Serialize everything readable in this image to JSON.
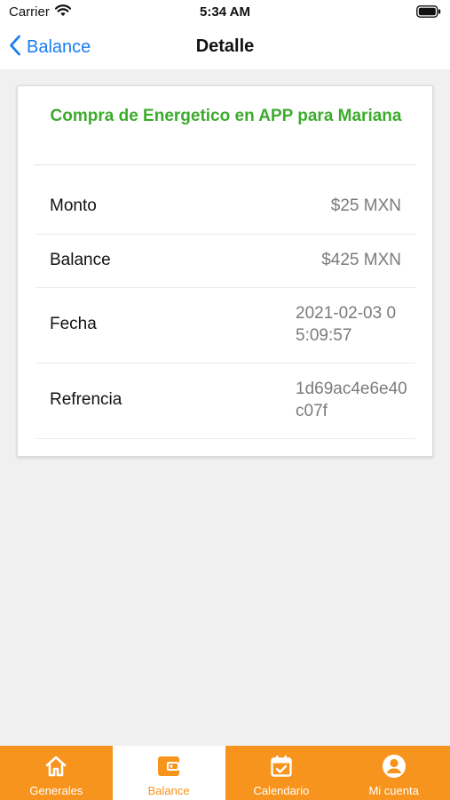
{
  "status_bar": {
    "carrier": "Carrier",
    "time": "5:34 AM"
  },
  "nav": {
    "back_label": "Balance",
    "title": "Detalle"
  },
  "detail": {
    "title": "Compra de Energetico en APP para Mariana",
    "rows": [
      {
        "label": "Monto",
        "value": "$25 MXN"
      },
      {
        "label": "Balance",
        "value": "$425 MXN"
      },
      {
        "label": "Fecha",
        "value": "2021-02-03 05:09:57"
      },
      {
        "label": "Refrencia",
        "value": "1d69ac4e6e40c07f"
      }
    ]
  },
  "tabs": [
    {
      "label": "Generales",
      "icon": "home-icon",
      "active": false
    },
    {
      "label": "Balance",
      "icon": "wallet-icon",
      "active": true
    },
    {
      "label": "Calendario",
      "icon": "calendar-check-icon",
      "active": false
    },
    {
      "label": "Mi cuenta",
      "icon": "account-circle-icon",
      "active": false
    }
  ],
  "colors": {
    "accent_orange": "#f7941d",
    "title_green": "#3cab2c",
    "link_blue": "#1a7cf0",
    "value_gray": "#7b7b7b",
    "background": "#f0f0f0"
  }
}
